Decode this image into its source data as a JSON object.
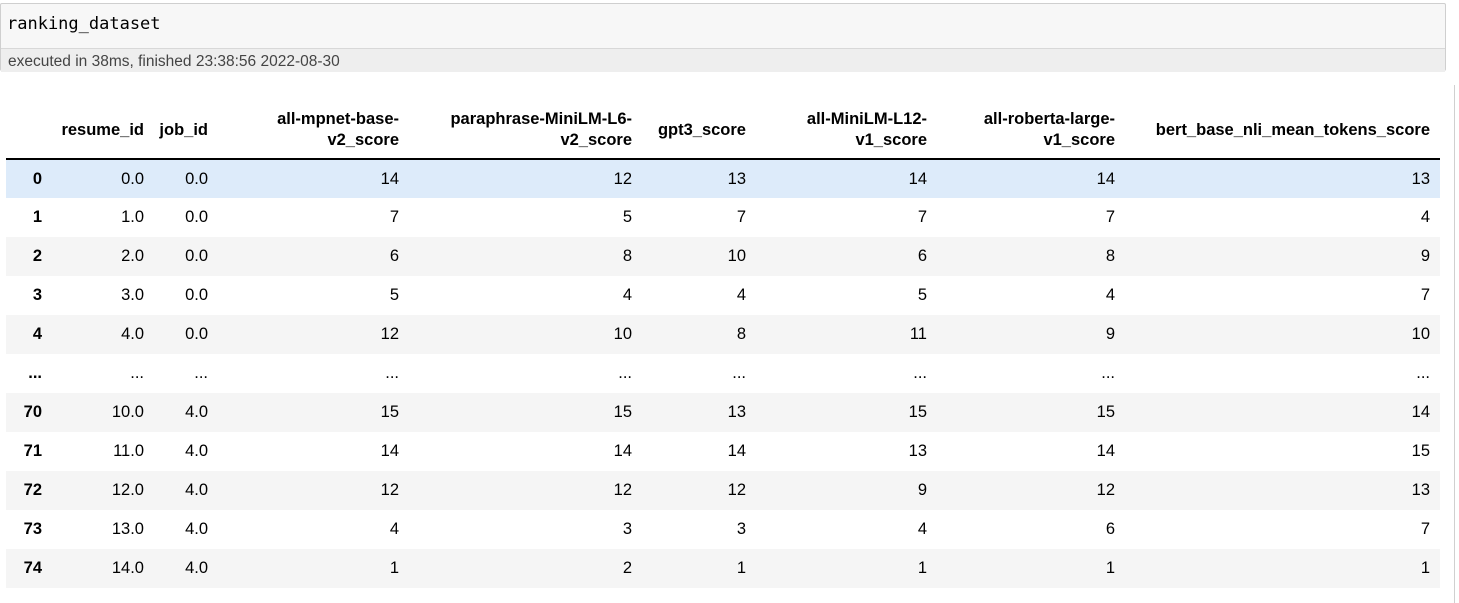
{
  "cell": {
    "code": "ranking_dataset",
    "exec_info": "executed in 38ms, finished 23:38:56 2022-08-30"
  },
  "table": {
    "columns": [
      "",
      "resume_id",
      "job_id",
      "all-mpnet-base-\nv2_score",
      "paraphrase-MiniLM-L6-\nv2_score",
      "gpt3_score",
      "all-MiniLM-L12-\nv1_score",
      "all-roberta-large-\nv1_score",
      "bert_base_nli_mean_tokens_score"
    ],
    "rows": [
      [
        "0",
        "0.0",
        "0.0",
        "14",
        "12",
        "13",
        "14",
        "14",
        "13"
      ],
      [
        "1",
        "1.0",
        "0.0",
        "7",
        "5",
        "7",
        "7",
        "7",
        "4"
      ],
      [
        "2",
        "2.0",
        "0.0",
        "6",
        "8",
        "10",
        "6",
        "8",
        "9"
      ],
      [
        "3",
        "3.0",
        "0.0",
        "5",
        "4",
        "4",
        "5",
        "4",
        "7"
      ],
      [
        "4",
        "4.0",
        "0.0",
        "12",
        "10",
        "8",
        "11",
        "9",
        "10"
      ],
      [
        "...",
        "...",
        "...",
        "...",
        "...",
        "...",
        "...",
        "...",
        "..."
      ],
      [
        "70",
        "10.0",
        "4.0",
        "15",
        "15",
        "13",
        "15",
        "15",
        "14"
      ],
      [
        "71",
        "11.0",
        "4.0",
        "14",
        "14",
        "14",
        "13",
        "14",
        "15"
      ],
      [
        "72",
        "12.0",
        "4.0",
        "12",
        "12",
        "12",
        "9",
        "12",
        "13"
      ],
      [
        "73",
        "13.0",
        "4.0",
        "4",
        "3",
        "3",
        "4",
        "6",
        "7"
      ],
      [
        "74",
        "14.0",
        "4.0",
        "1",
        "2",
        "1",
        "1",
        "1",
        "1"
      ]
    ],
    "highlighted_row": 0
  }
}
